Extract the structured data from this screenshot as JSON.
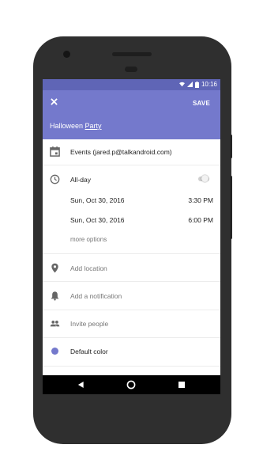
{
  "status": {
    "time": "10:16"
  },
  "appbar": {
    "save_label": "SAVE",
    "title_prefix": "Halloween ",
    "title_underlined": "Party"
  },
  "calendar": {
    "label": "Events (jared.p@talkandroid.com)"
  },
  "allday": {
    "label": "All-day",
    "value": false
  },
  "dates": [
    {
      "date": "Sun, Oct 30, 2016",
      "time": "3:30 PM"
    },
    {
      "date": "Sun, Oct 30, 2016",
      "time": "6:00 PM"
    }
  ],
  "more_options": "more options",
  "location": {
    "placeholder": "Add location"
  },
  "notification": {
    "placeholder": "Add a notification"
  },
  "people": {
    "placeholder": "Invite people"
  },
  "color": {
    "label": "Default color",
    "swatch": "#7479cc"
  },
  "colors": {
    "accent": "#7479cc",
    "statusbar": "#5f65b6"
  },
  "icons": [
    "close-icon",
    "calendar-icon",
    "clock-icon",
    "location-pin-icon",
    "bell-icon",
    "people-icon",
    "back-icon",
    "home-icon",
    "recents-icon",
    "wifi-icon",
    "signal-icon",
    "battery-icon"
  ]
}
